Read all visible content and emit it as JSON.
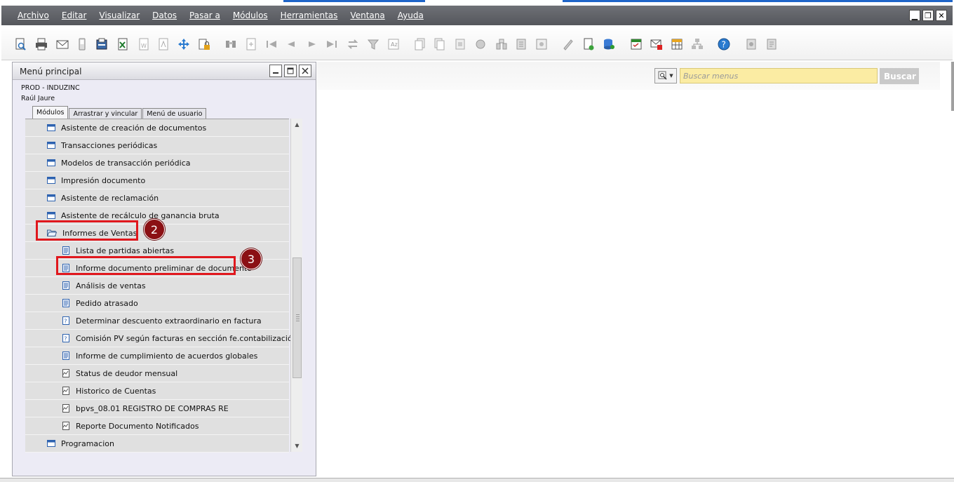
{
  "menubar": {
    "items": [
      "Archivo",
      "Editar",
      "Visualizar",
      "Datos",
      "Pasar a",
      "Módulos",
      "Herramientas",
      "Ventana",
      "Ayuda"
    ]
  },
  "window_controls": {
    "minimize": "▁",
    "restore": "❐",
    "close": "✕"
  },
  "toolbar": {
    "icons": [
      "preview-icon",
      "print-icon",
      "email-icon",
      "sms-icon",
      "fax-icon",
      "excel-icon",
      "word-icon",
      "pdf-icon",
      "move-icon",
      "lock-icon",
      "find-icon",
      "add-icon",
      "first-icon",
      "previous-icon",
      "next-icon",
      "last-icon",
      "refresh-icon",
      "filter-icon",
      "sort-icon",
      "base-doc-icon",
      "target-doc-icon",
      "doc-icon",
      "gross-profit-icon",
      "tree-icon",
      "calc-icon",
      "journal-icon",
      "pen-icon",
      "new-doc-icon",
      "db-settings-icon",
      "calendar-icon",
      "mail-cancel-icon",
      "table-icon",
      "hierarchy-icon",
      "help-icon",
      "settings-icon",
      "settings2-icon"
    ]
  },
  "left_panel": {
    "title": "Menú principal",
    "company": "PROD - INDUZINC",
    "user": "Raúl Jaure",
    "tabs": [
      "Módulos",
      "Arrastrar y vincular",
      "Menú de usuario"
    ],
    "items": [
      {
        "label": "Asistente de creación de documentos",
        "icon": "window-icon",
        "level": 0
      },
      {
        "label": "Transacciones periódicas",
        "icon": "window-icon",
        "level": 0
      },
      {
        "label": "Modelos de transacción periódica",
        "icon": "window-icon",
        "level": 0
      },
      {
        "label": "Impresión documento",
        "icon": "window-icon",
        "level": 0
      },
      {
        "label": "Asistente de reclamación",
        "icon": "window-icon",
        "level": 0
      },
      {
        "label": "Asistente de recálculo de ganancia bruta",
        "icon": "window-icon",
        "level": 0
      },
      {
        "label": "Informes de Ventas",
        "icon": "folder-open-icon",
        "level": 0
      },
      {
        "label": "Lista de partidas abiertas",
        "icon": "report-icon",
        "level": 1
      },
      {
        "label": "Informe documento preliminar de documento",
        "icon": "report-icon",
        "level": 1
      },
      {
        "label": "Análisis de ventas",
        "icon": "report-icon",
        "level": 1
      },
      {
        "label": "Pedido atrasado",
        "icon": "report-icon",
        "level": 1
      },
      {
        "label": "Determinar descuento extraordinario en factura",
        "icon": "query-icon",
        "level": 1
      },
      {
        "label": "Comisión PV según facturas en sección fe.contabilización",
        "icon": "query-icon",
        "level": 1
      },
      {
        "label": "Informe de cumplimiento de acuerdos globales",
        "icon": "report-icon",
        "level": 1
      },
      {
        "label": "Status de deudor mensual",
        "icon": "crystal-icon",
        "level": 1
      },
      {
        "label": "Historico de Cuentas",
        "icon": "crystal-icon",
        "level": 1
      },
      {
        "label": "bpvs_08.01 REGISTRO DE COMPRAS RE",
        "icon": "crystal-icon",
        "level": 1
      },
      {
        "label": "Reporte Documento Notificados",
        "icon": "crystal-icon",
        "level": 1
      },
      {
        "label": "Programacion",
        "icon": "window-icon",
        "level": 0
      }
    ]
  },
  "callouts": {
    "first": "2",
    "second": "3"
  },
  "search": {
    "placeholder": "Buscar menus",
    "value": "",
    "button": "Buscar"
  },
  "colors": {
    "highlight": "#e0171d",
    "callout": "#8b1014",
    "search_bg": "#fbeca3"
  }
}
